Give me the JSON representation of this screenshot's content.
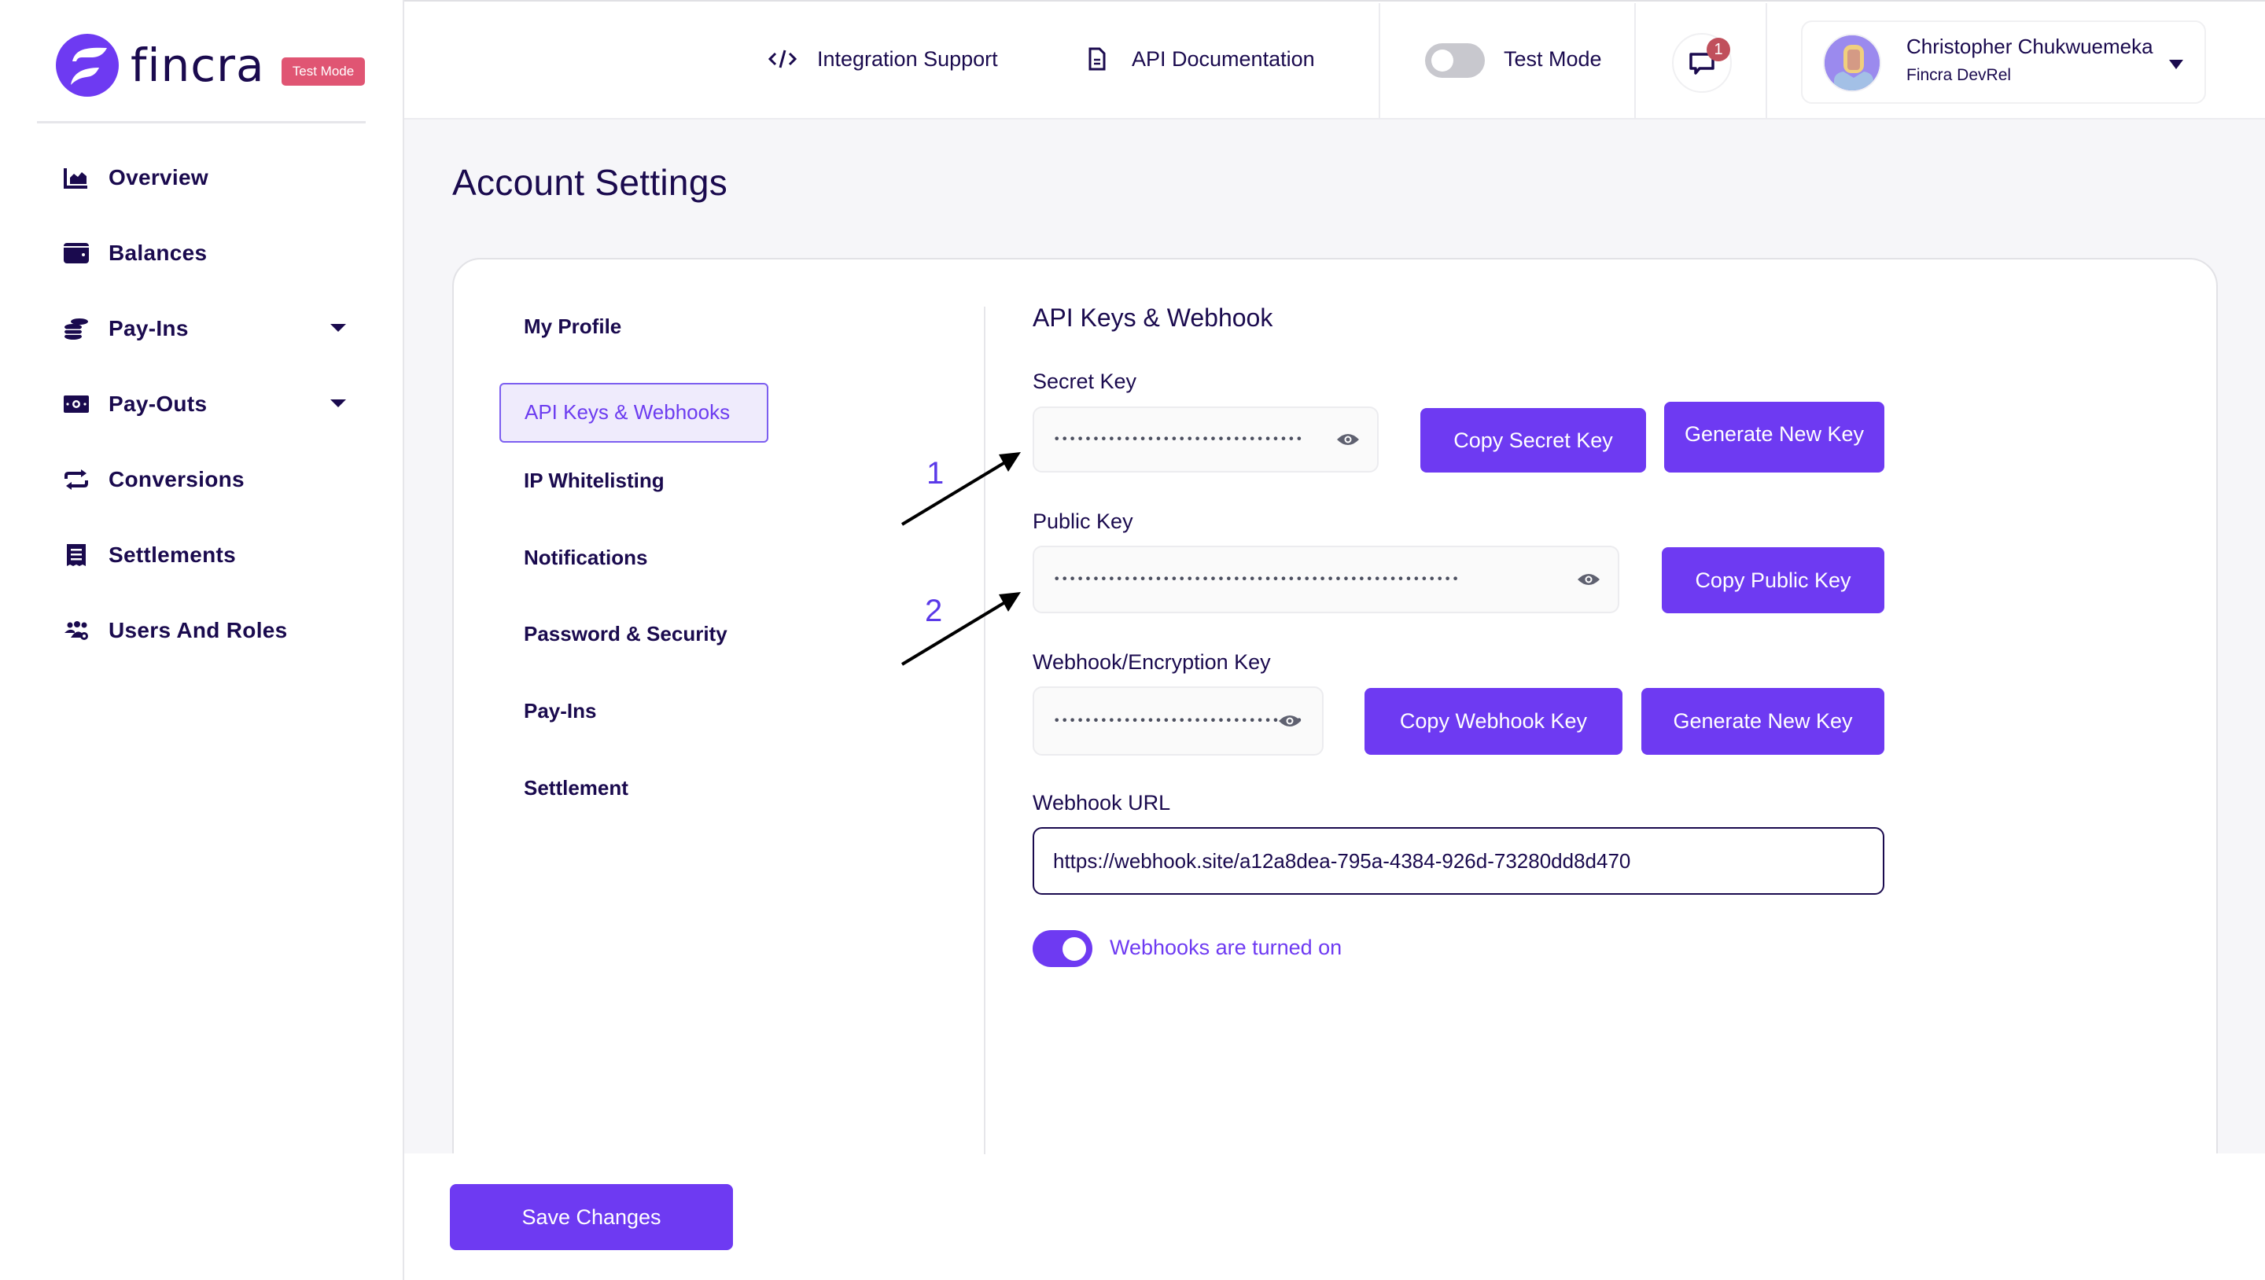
{
  "brand": {
    "name": "fincra",
    "badge": "Test Mode",
    "accent": "#6e3af2",
    "badge_color": "#e05573",
    "text_color": "#1a0a4e"
  },
  "sidebar": {
    "items": [
      {
        "label": "Overview",
        "icon": "chart-area-icon",
        "has_caret": false
      },
      {
        "label": "Balances",
        "icon": "wallet-icon",
        "has_caret": false
      },
      {
        "label": "Pay-Ins",
        "icon": "coins-icon",
        "has_caret": true
      },
      {
        "label": "Pay-Outs",
        "icon": "money-bill-icon",
        "has_caret": true
      },
      {
        "label": "Conversions",
        "icon": "exchange-icon",
        "has_caret": false
      },
      {
        "label": "Settlements",
        "icon": "receipt-icon",
        "has_caret": false
      },
      {
        "label": "Users And Roles",
        "icon": "users-cog-icon",
        "has_caret": false
      }
    ]
  },
  "topbar": {
    "integration_support": "Integration Support",
    "api_documentation": "API Documentation",
    "test_mode_label": "Test Mode",
    "test_mode_on": false,
    "notification_count": "1",
    "user": {
      "name": "Christopher Chukwuemeka",
      "role": "Fincra DevRel"
    }
  },
  "page": {
    "title": "Account Settings"
  },
  "settings_nav": {
    "items": [
      "My Profile",
      "API Keys & Webhooks",
      "IP Whitelisting",
      "Notifications",
      "Password & Security",
      "Pay-Ins",
      "Settlement"
    ],
    "active": "API Keys & Webhooks"
  },
  "api_panel": {
    "heading": "API Keys & Webhook",
    "secret_key": {
      "label": "Secret Key",
      "masked_value": "••••••••••••••••••••••••••••••••",
      "copy_label": "Copy Secret Key",
      "generate_label": "Generate New Key"
    },
    "public_key": {
      "label": "Public Key",
      "masked_value": "••••••••••••••••••••••••••••••••••••••••••••••••••••",
      "copy_label": "Copy Public Key"
    },
    "webhook_key": {
      "label": "Webhook/Encryption Key",
      "masked_value": "••••••••••••••••••••••••••••••••",
      "copy_label": "Copy Webhook Key",
      "generate_label": "Generate New Key"
    },
    "webhook_url": {
      "label": "Webhook URL",
      "value": "https://webhook.site/a12a8dea-795a-4384-926d-73280dd8d470"
    },
    "webhooks_enabled": true,
    "webhooks_status": "Webhooks are turned on"
  },
  "annotations": {
    "labels": [
      "1",
      "2"
    ]
  },
  "footer": {
    "save_label": "Save Changes"
  }
}
